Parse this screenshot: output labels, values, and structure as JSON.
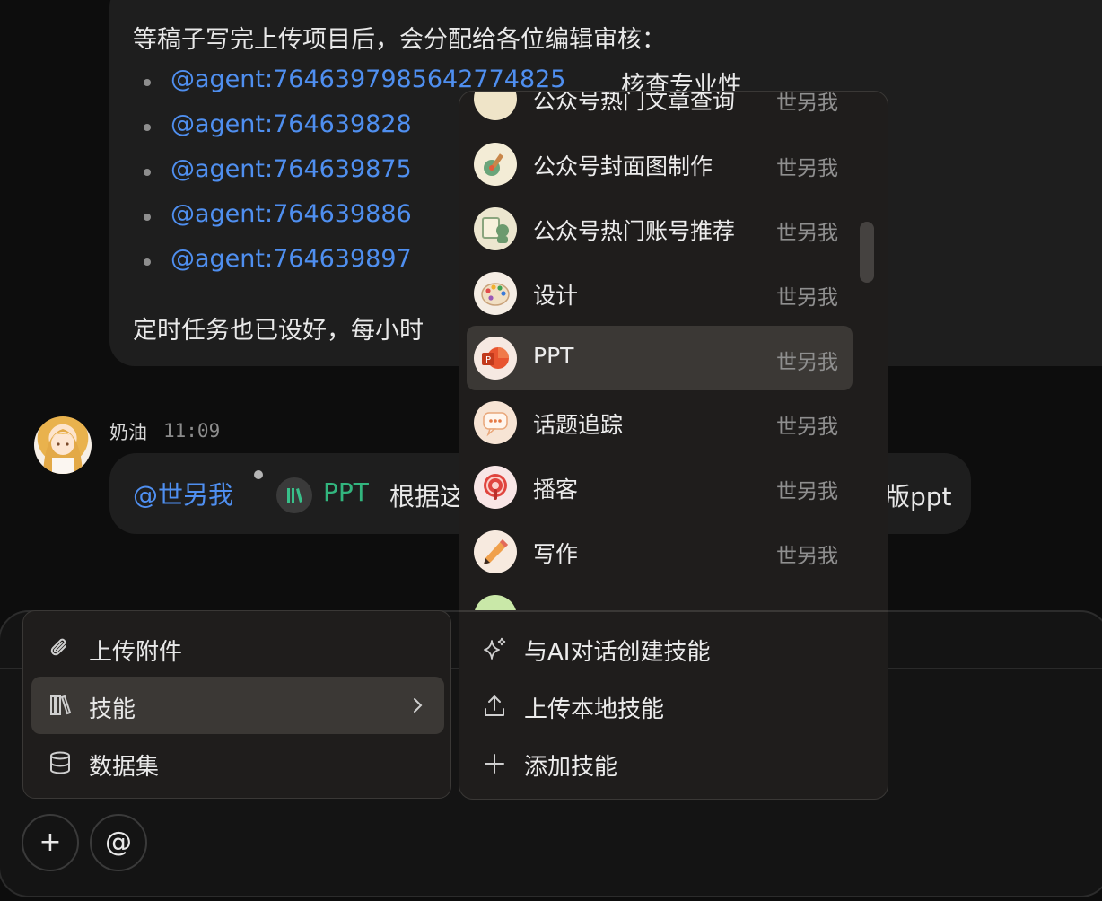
{
  "chat": {
    "message1": {
      "intro": "等稿子写完上传项目后，会分配给各位编辑审核：",
      "mentions": [
        {
          "agent": "@agent:7646397985642774825",
          "note": "核查专业性"
        },
        {
          "agent": "@agent:764639828",
          "note": ""
        },
        {
          "agent": "@agent:764639875",
          "note": ""
        },
        {
          "agent": "@agent:764639886",
          "note": ""
        },
        {
          "agent": "@agent:764639897",
          "note": ""
        }
      ],
      "footer": "定时任务也已设好，每小时"
    },
    "message2": {
      "sender": "奶油",
      "time": "11:09",
      "mention": "@世另我",
      "skill_icon": "skill-library-icon",
      "skill": "PPT",
      "text": "根据这",
      "tail": "版ppt"
    }
  },
  "attach_menu": {
    "items": [
      {
        "label": "上传附件",
        "icon": "paperclip-icon"
      },
      {
        "label": "技能",
        "icon": "skill-library-icon",
        "active": true
      },
      {
        "label": "数据集",
        "icon": "database-icon"
      }
    ]
  },
  "skills_menu": {
    "partial_top": {
      "name": "公众号热门文章查询",
      "owner": "世另我"
    },
    "skills": [
      {
        "name": "公众号封面图制作",
        "owner": "世另我",
        "icon": "guitar-cover-icon"
      },
      {
        "name": "公众号热门账号推荐",
        "owner": "世另我",
        "icon": "account-recommend-icon"
      },
      {
        "name": "设计",
        "owner": "世另我",
        "icon": "palette-icon"
      },
      {
        "name": "PPT",
        "owner": "世另我",
        "icon": "powerpoint-icon",
        "active": true
      },
      {
        "name": "话题追踪",
        "owner": "世另我",
        "icon": "chat-bubble-icon"
      },
      {
        "name": "播客",
        "owner": "世另我",
        "icon": "podcast-icon"
      },
      {
        "name": "写作",
        "owner": "世另我",
        "icon": "pencil-icon"
      }
    ],
    "actions": [
      {
        "label": "与AI对话创建技能",
        "icon": "sparkle-icon"
      },
      {
        "label": "上传本地技能",
        "icon": "upload-icon"
      },
      {
        "label": "添加技能",
        "icon": "plus-icon"
      }
    ]
  },
  "composer": {
    "add_label": "+",
    "mention_label": "@"
  }
}
